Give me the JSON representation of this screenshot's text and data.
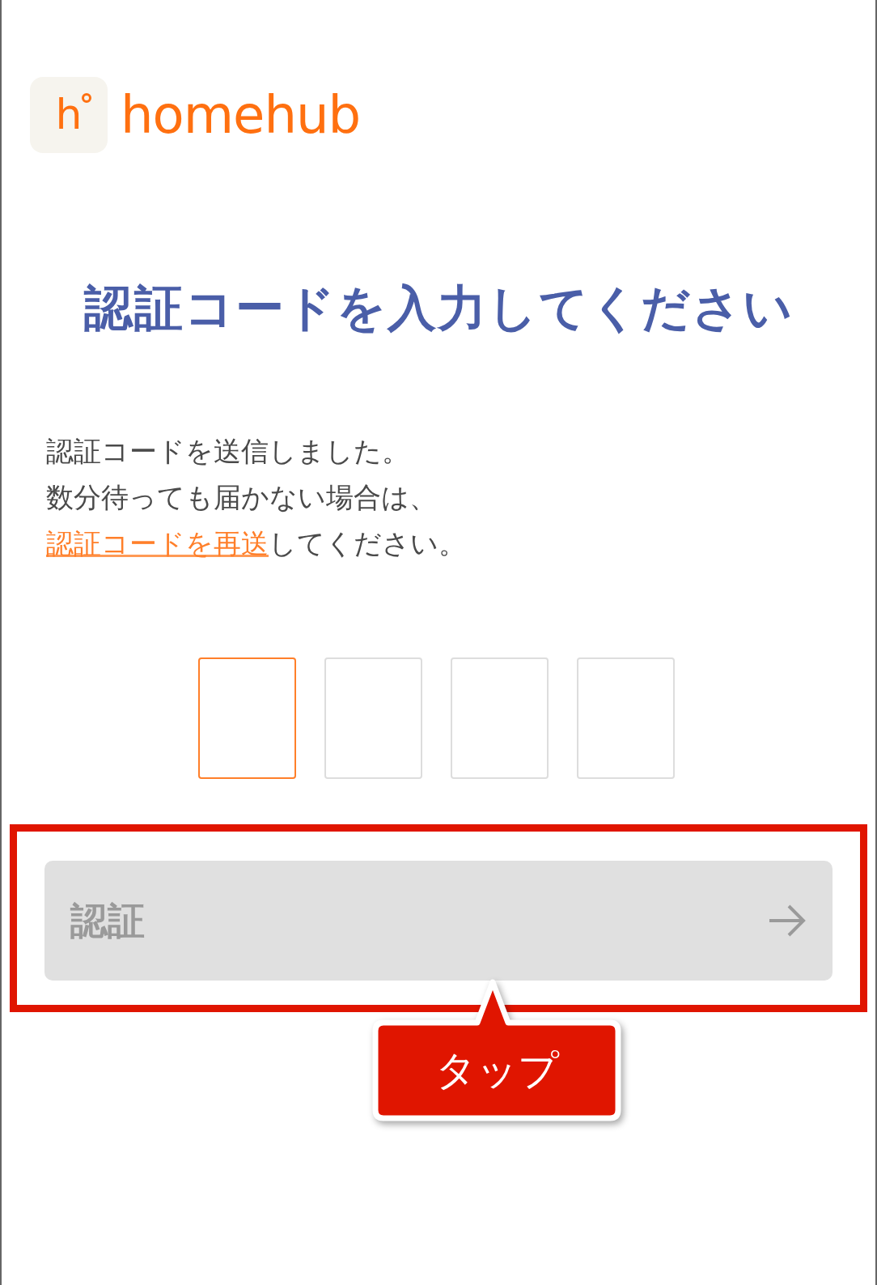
{
  "logo": {
    "mark": "h",
    "name": "homehub"
  },
  "title": "認証コードを入力してください",
  "message": {
    "lines": [
      "認証コードを送信しました。",
      "数分待っても届かない場合は、"
    ],
    "resend_link": "認証コードを再送",
    "tail": "してください。"
  },
  "code_inputs": [
    {
      "selected": true
    },
    {
      "selected": false
    },
    {
      "selected": false
    },
    {
      "selected": false
    }
  ],
  "verify_button": {
    "label": "認証",
    "disabled": true
  },
  "callout": {
    "label": "タップ"
  }
}
